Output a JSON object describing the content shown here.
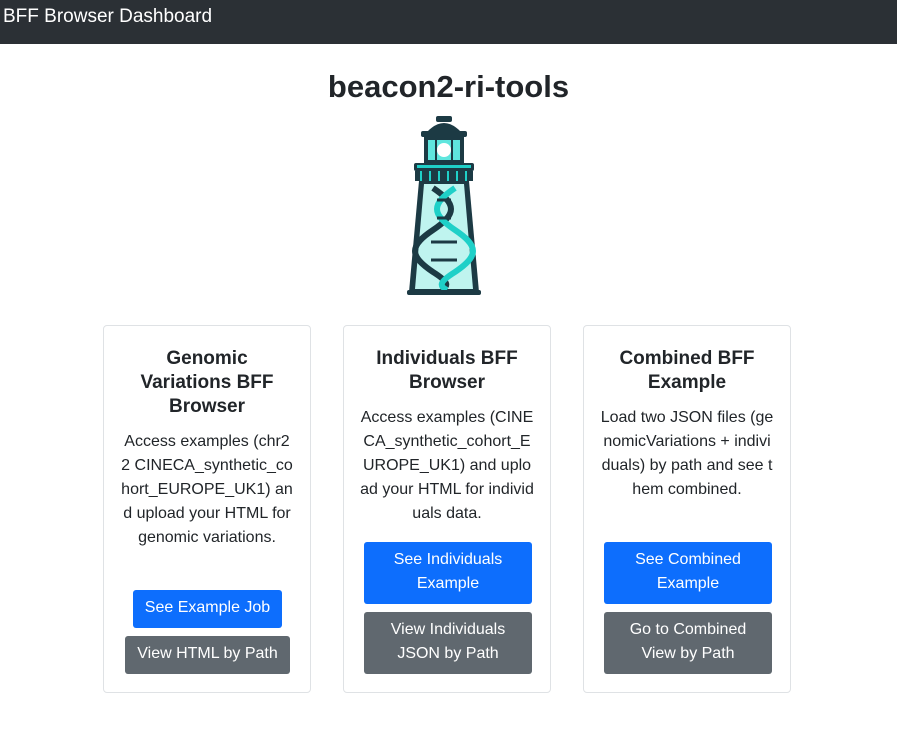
{
  "navbar": {
    "brand": "BFF Browser Dashboard"
  },
  "header": {
    "title": "beacon2-ri-tools",
    "logo_icon": "lighthouse-dna-icon"
  },
  "cards": [
    {
      "title": "Genomic Variations BFF Browser",
      "text": "Access examples (chr22 CINECA_synthetic_cohort_EUROPE_UK1) and upload your HTML for genomic variations.",
      "primary_button": "See Example Job",
      "secondary_button": "View HTML by Path"
    },
    {
      "title": "Individuals BFF Browser",
      "text": "Access examples (CINECA_synthetic_cohort_EUROPE_UK1) and upload your HTML for individuals data.",
      "primary_button": "See Individuals Example",
      "secondary_button": "View Individuals JSON by Path"
    },
    {
      "title": "Combined BFF Example",
      "text": "Load two JSON files (genomicVariations + individuals) by path and see them combined.",
      "primary_button": "See Combined Example",
      "secondary_button": "Go to Combined View by Path"
    }
  ],
  "colors": {
    "navbar_bg": "#2b3035",
    "primary": "#0d6efd",
    "secondary": "#60686f",
    "logo_teal": "#1fd0c8",
    "logo_dark": "#1c3a44"
  }
}
